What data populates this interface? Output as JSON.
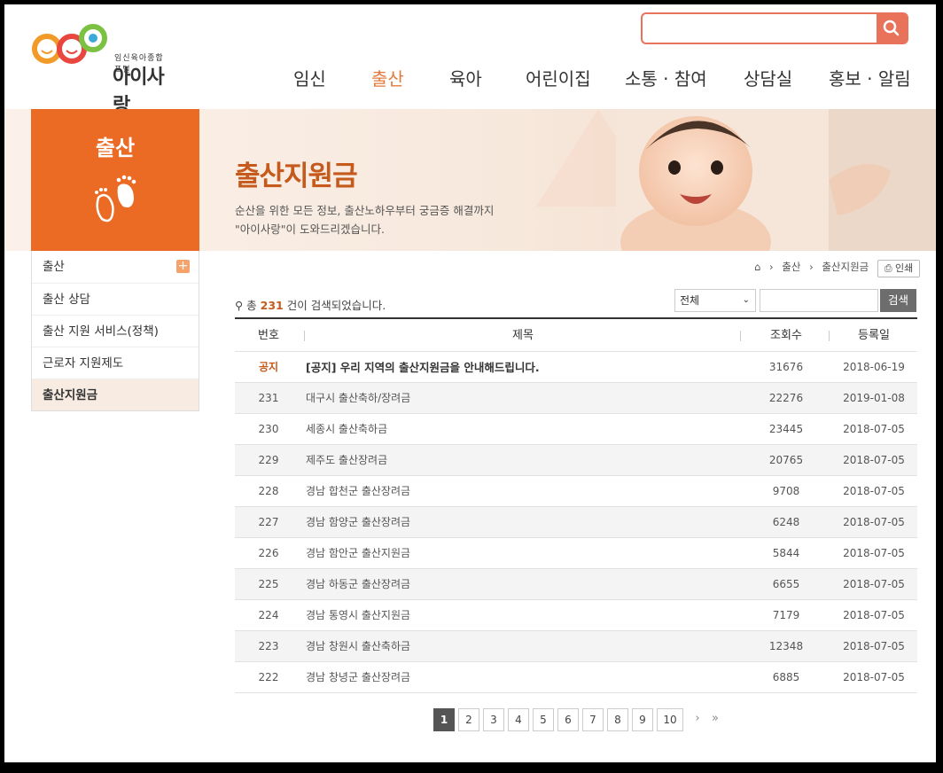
{
  "header": {
    "logo_sub": "임신육아종합포털",
    "logo_main": "아이사랑",
    "search_value": "",
    "nav": [
      "임신",
      "출산",
      "육아",
      "어린이집",
      "소통 · 참여",
      "상담실",
      "홍보 · 알림"
    ],
    "active_nav": "출산"
  },
  "banner": {
    "section": "출산",
    "title": "출산지원금",
    "desc_line1": "순산을 위한 모든 정보, 출산노하우부터 궁금증 해결까지",
    "desc_line2": "\"아이사랑\"이 도와드리겠습니다."
  },
  "lnb": {
    "items": [
      "출산",
      "출산 상담",
      "출산 지원 서비스(정책)",
      "근로자 지원제도",
      "출산지원금"
    ],
    "active": "출산지원금"
  },
  "breadcrumb": [
    "출산",
    "출산지원금"
  ],
  "print_label": "인쇄",
  "result": {
    "prefix": "총",
    "count": "231",
    "suffix": "건이 검색되었습니다."
  },
  "filter": {
    "selected": "전체",
    "query": "",
    "button": "검색"
  },
  "table": {
    "headers": [
      "번호",
      "제목",
      "조회수",
      "등록일"
    ],
    "notice": {
      "num": "공지",
      "title": "[공지] 우리 지역의 출산지원금을 안내해드립니다.",
      "views": "31676",
      "date": "2018-06-19"
    },
    "rows": [
      {
        "num": "231",
        "title": "대구시 출산축하/장려금",
        "views": "22276",
        "date": "2019-01-08"
      },
      {
        "num": "230",
        "title": "세종시 출산축하금",
        "views": "23445",
        "date": "2018-07-05"
      },
      {
        "num": "229",
        "title": "제주도 출산장려금",
        "views": "20765",
        "date": "2018-07-05"
      },
      {
        "num": "228",
        "title": "경남 합천군 출산장려금",
        "views": "9708",
        "date": "2018-07-05"
      },
      {
        "num": "227",
        "title": "경남 함양군 출산장려금",
        "views": "6248",
        "date": "2018-07-05"
      },
      {
        "num": "226",
        "title": "경남 함안군 출산지원금",
        "views": "5844",
        "date": "2018-07-05"
      },
      {
        "num": "225",
        "title": "경남 하동군 출산장려금",
        "views": "6655",
        "date": "2018-07-05"
      },
      {
        "num": "224",
        "title": "경남 통영시 출산지원금",
        "views": "7179",
        "date": "2018-07-05"
      },
      {
        "num": "223",
        "title": "경남 창원시 출산축하금",
        "views": "12348",
        "date": "2018-07-05"
      },
      {
        "num": "222",
        "title": "경남 창녕군 출산장려금",
        "views": "6885",
        "date": "2018-07-05"
      }
    ]
  },
  "pagination": {
    "pages": [
      "1",
      "2",
      "3",
      "4",
      "5",
      "6",
      "7",
      "8",
      "9",
      "10"
    ],
    "current": "1",
    "next": "›",
    "last": "»"
  },
  "colors": {
    "accent": "#eb6b24",
    "title": "#c55a1c",
    "search_border": "#e8735a"
  }
}
